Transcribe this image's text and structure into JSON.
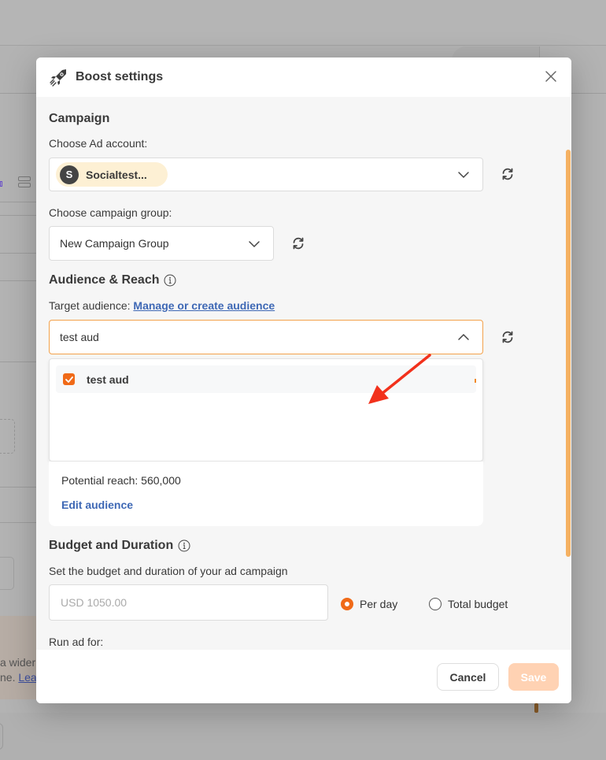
{
  "background": {
    "banner_line1": "a wider",
    "banner_line2_prefix": "ne. ",
    "banner_link": "Lea"
  },
  "modal": {
    "title": "Boost settings",
    "header_icon": "rocket-icon",
    "close_icon": "close-icon",
    "campaign": {
      "section_title": "Campaign",
      "ad_account_label": "Choose Ad account:",
      "ad_account": {
        "avatar_letter": "S",
        "name": "Socialtest..."
      },
      "campaign_group_label": "Choose campaign group:",
      "campaign_group_value": "New Campaign Group"
    },
    "audience": {
      "section_title": "Audience & Reach",
      "target_label": "Target audience: ",
      "manage_link": "Manage or create audience",
      "selected_value": "test aud",
      "dropdown_open": true,
      "options": [
        {
          "label": "test aud",
          "checked": true
        }
      ],
      "potential_reach_label": "Potential reach: ",
      "potential_reach_value": "560,000",
      "edit_audience": "Edit audience"
    },
    "budget": {
      "section_title": "Budget and Duration",
      "description": "Set the budget and duration of your ad campaign",
      "amount_placeholder": "USD 1050.00",
      "options": [
        {
          "label": "Per day",
          "selected": true
        },
        {
          "label": "Total budget",
          "selected": false
        }
      ],
      "run_ad_label": "Run ad for:"
    },
    "footer": {
      "cancel_label": "Cancel",
      "save_label": "Save"
    }
  },
  "colors": {
    "accent": "#f06a18",
    "scrollbar": "#f5b162",
    "link": "#3e68b5",
    "save_disabled": "#ffd2b3",
    "annotation_arrow": "#f2311c",
    "account_chip": "#fdf0d4"
  }
}
